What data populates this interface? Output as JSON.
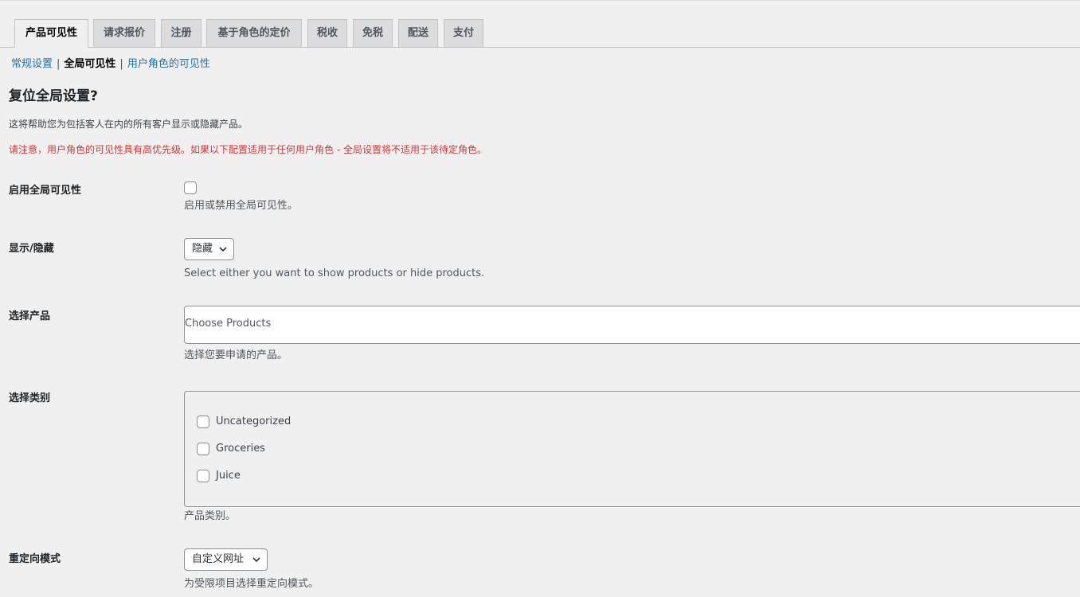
{
  "tabs": [
    {
      "label": "产品可见性",
      "active": true
    },
    {
      "label": "请求报价"
    },
    {
      "label": "注册"
    },
    {
      "label": "基于角色的定价"
    },
    {
      "label": "税收"
    },
    {
      "label": "免税"
    },
    {
      "label": "配送"
    },
    {
      "label": "支付"
    }
  ],
  "subnav": {
    "general": "常规设置",
    "separator": "|",
    "global": "全局可见性",
    "role": "用户角色的可见性"
  },
  "section": {
    "title": "复位全局设置?",
    "description": "这将帮助您为包括客人在内的所有客户显示或隐藏产品。",
    "notice": "请注意，用户角色的可见性具有高优先级。如果以下配置适用于任何用户角色 - 全局设置将不适用于该待定角色。"
  },
  "fields": {
    "enable": {
      "label": "启用全局可见性",
      "help": "启用或禁用全局可见性。",
      "checked": false
    },
    "show_hide": {
      "label": "显示/隐藏",
      "selected": "隐藏",
      "help": "Select either you want to show products or hide products."
    },
    "products": {
      "label": "选择产品",
      "placeholder": "Choose Products",
      "help": "选择您要申请的产品。"
    },
    "categories": {
      "label": "选择类别",
      "items": [
        {
          "label": "Uncategorized",
          "checked": false
        },
        {
          "label": "Groceries",
          "checked": false
        },
        {
          "label": "Juice",
          "checked": false
        }
      ],
      "help": "产品类别。"
    },
    "redirect": {
      "label": "重定向模式",
      "selected": "自定义网址",
      "help": "为受限项目选择重定向模式。"
    }
  },
  "colors": {
    "link": "#2271b1",
    "notice": "#d63638",
    "background": "#f0f0f1"
  }
}
